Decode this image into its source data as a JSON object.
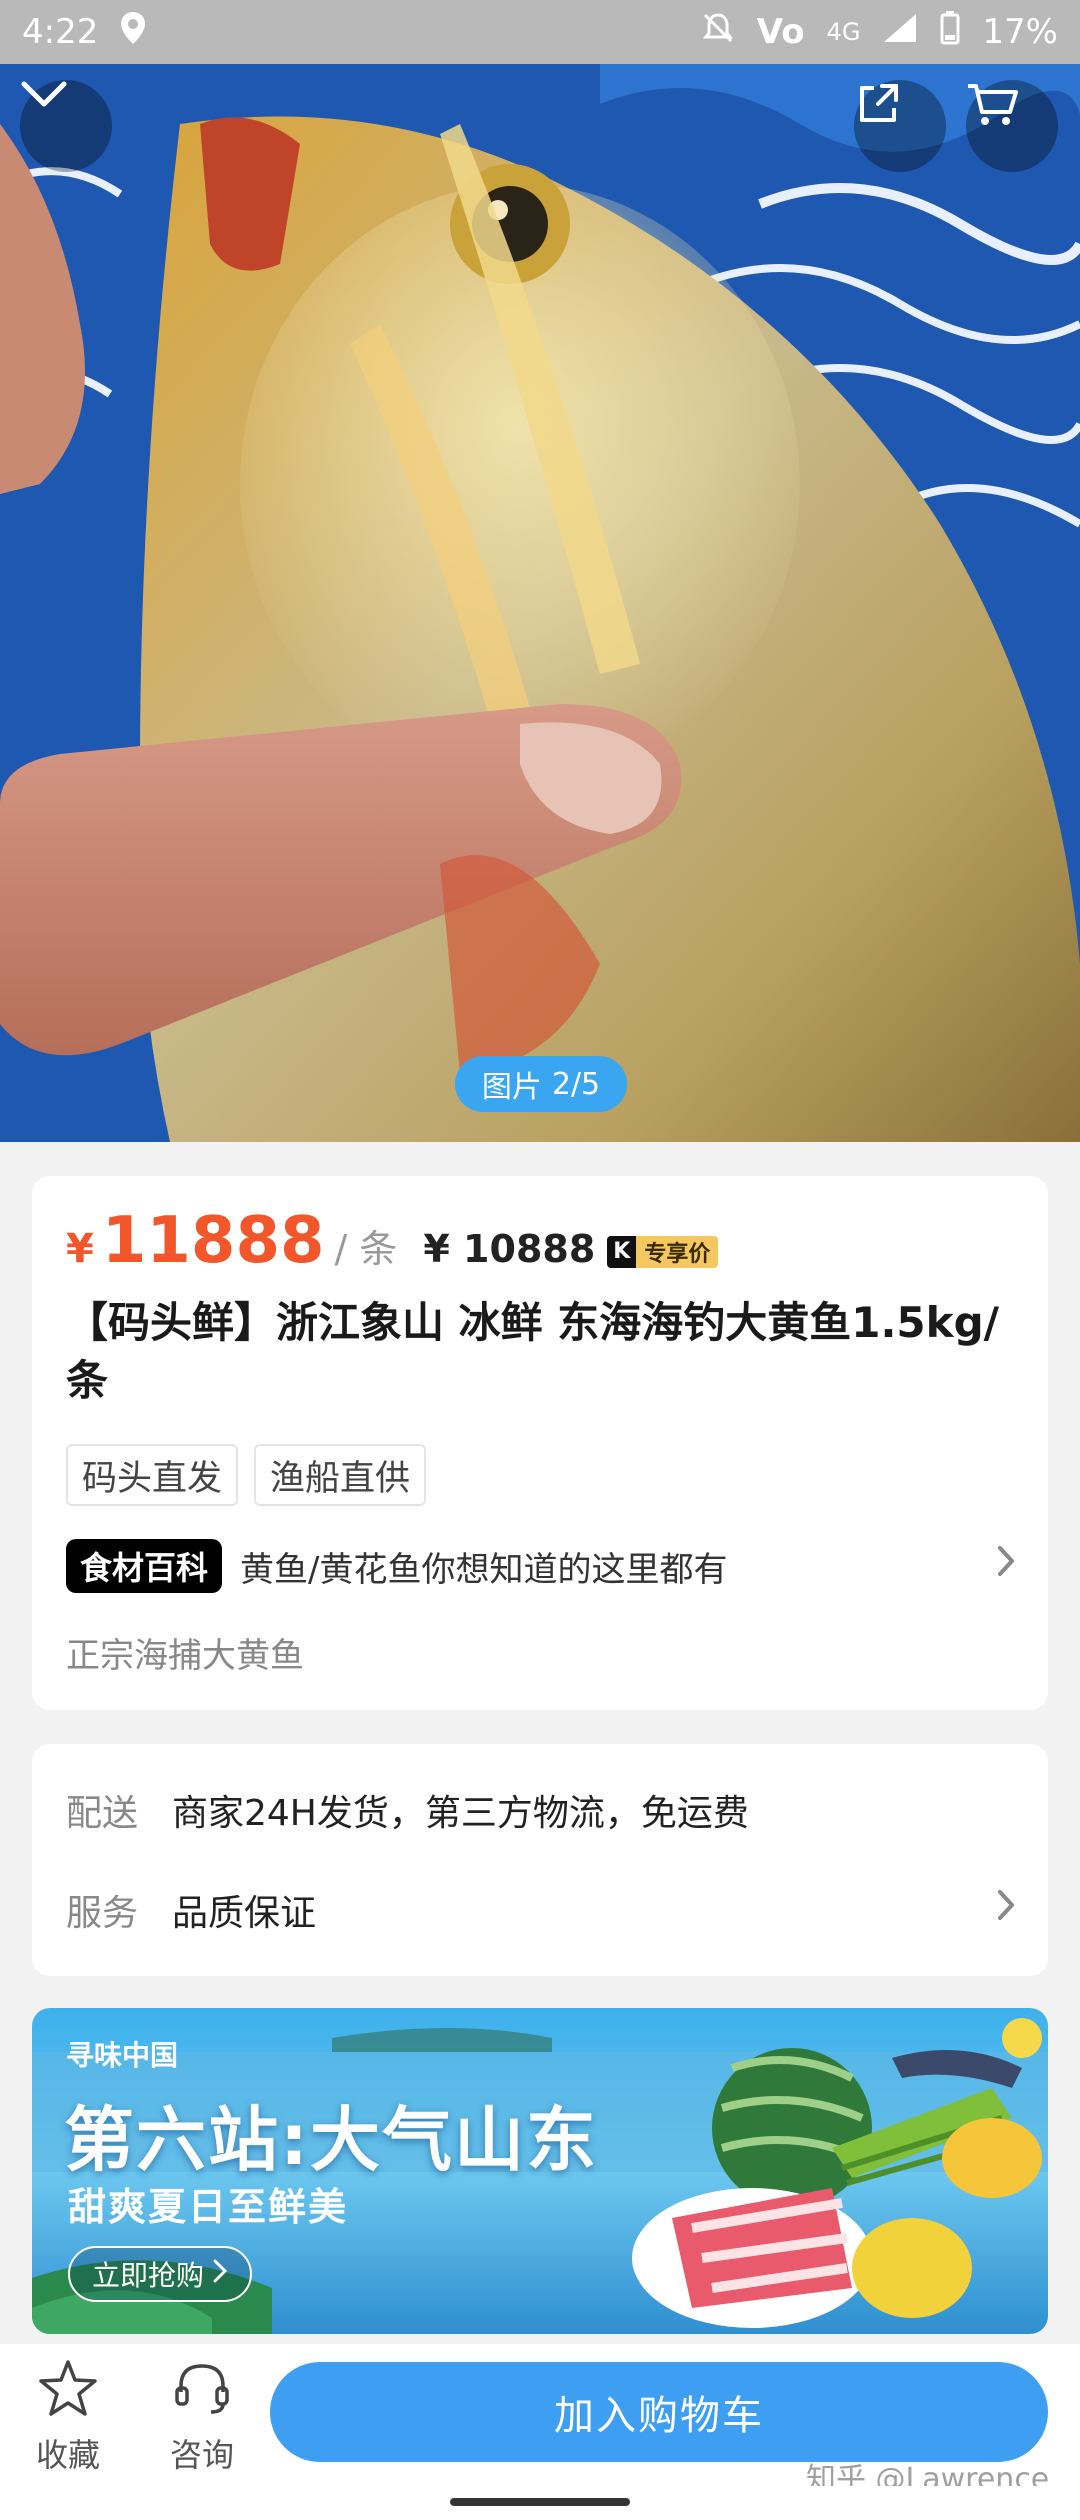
{
  "status_bar": {
    "time": "4:22",
    "battery": "17%",
    "network": "4G",
    "volte": "Vo",
    "icons": [
      "location-icon",
      "mute-icon",
      "signal-icon",
      "battery-icon"
    ]
  },
  "gallery": {
    "indicator_label": "图片",
    "indicator_count": "2/5",
    "icons": [
      "chevron-down-icon",
      "share-icon",
      "cart-icon"
    ]
  },
  "product": {
    "currency": "¥",
    "price": "11888",
    "unit": "/ 条",
    "member_price": "¥ 10888",
    "member_badge_mark": "K",
    "member_badge_label": "专享价",
    "title": "【码头鲜】浙江象山 冰鲜 东海海钓大黄鱼1.5kg/条",
    "tags": [
      "码头直发",
      "渔船直供"
    ],
    "wiki_badge": "食材百科",
    "wiki_text": "黄鱼/黄花鱼你想知道的这里都有",
    "description": "正宗海捕大黄鱼"
  },
  "service": {
    "delivery_label": "配送",
    "delivery_value": "商家24H发货，第三方物流，免运费",
    "service_label": "服务",
    "service_value": "品质保证"
  },
  "banner": {
    "brand": "寻味中国",
    "title": "第六站:大气山东",
    "subtitle": "甜爽夏日至鲜美",
    "button": "立即抢购"
  },
  "bottom_bar": {
    "favorite_label": "收藏",
    "consult_label": "咨询",
    "add_to_cart": "加入购物车"
  },
  "watermark": "知乎 @Lawrence",
  "colors": {
    "accent_price": "#f2562b",
    "primary_blue": "#3e9ff2",
    "indicator_blue": "#3aa6f2"
  }
}
